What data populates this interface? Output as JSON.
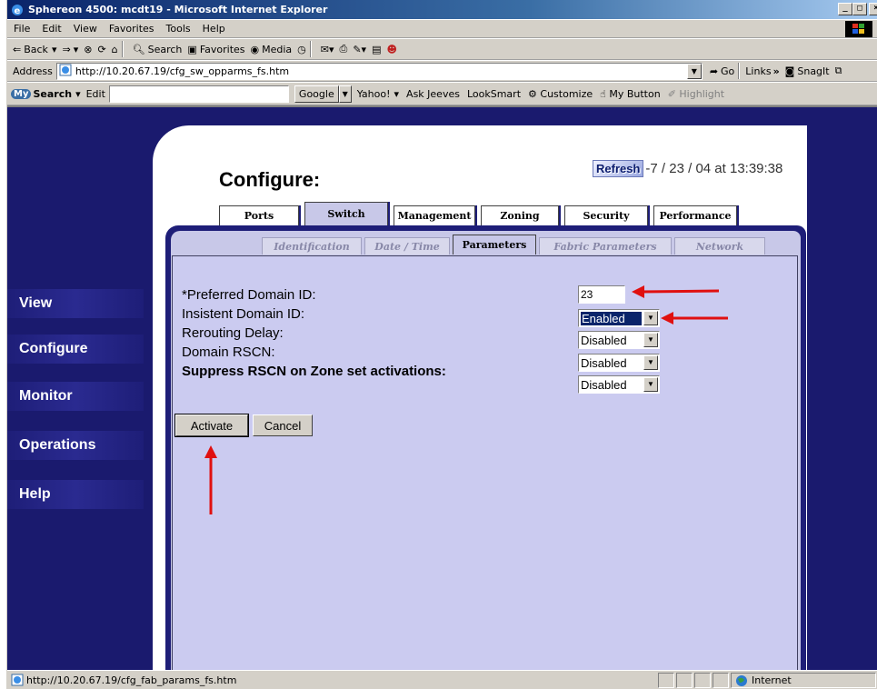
{
  "window": {
    "title": "Sphereon 4500: mcdt19 - Microsoft Internet Explorer"
  },
  "menu": [
    "File",
    "Edit",
    "View",
    "Favorites",
    "Tools",
    "Help"
  ],
  "toolbar": {
    "back": "Back",
    "search": "Search",
    "favorites": "Favorites",
    "media": "Media"
  },
  "address": {
    "label": "Address",
    "url": "http://10.20.67.19/cfg_sw_opparms_fs.htm",
    "go": "Go",
    "links": "Links",
    "snagit": "SnagIt"
  },
  "searchbar": {
    "brand": "Search",
    "edit": "Edit",
    "google": "Google",
    "items": [
      "Yahoo!",
      "Ask Jeeves",
      "LookSmart",
      "Customize",
      "My Button",
      "Highlight"
    ]
  },
  "page": {
    "title": "Configure:",
    "refresh_label": "Refresh",
    "refresh_time": "-7 / 23 / 04 at 13:39:38"
  },
  "tabs": [
    "Ports",
    "Switch",
    "Management",
    "Zoning",
    "Security",
    "Performance"
  ],
  "subtabs": [
    "Identification",
    "Date / Time",
    "Parameters",
    "Fabric Parameters",
    "Network"
  ],
  "form": {
    "preferred_domain_label": "*Preferred Domain ID:",
    "preferred_domain_value": "23",
    "insistent_label": "Insistent Domain ID:",
    "insistent_value": "Enabled",
    "rerouting_label": "Rerouting Delay:",
    "rerouting_value": "Disabled",
    "rscn_label": "Domain RSCN:",
    "rscn_value": "Disabled",
    "suppress_label": "Suppress RSCN on Zone set activations:",
    "suppress_value": "Disabled",
    "activate": "Activate",
    "cancel": "Cancel"
  },
  "nav": [
    "View",
    "Configure",
    "Monitor",
    "Operations",
    "Help"
  ],
  "status": {
    "url": "http://10.20.67.19/cfg_fab_params_fs.htm",
    "zone": "Internet"
  },
  "colors": {
    "nav_bg": "#1e1e78",
    "panel_lavender": "#cbcbf0",
    "annotation_red": "#e01010"
  }
}
